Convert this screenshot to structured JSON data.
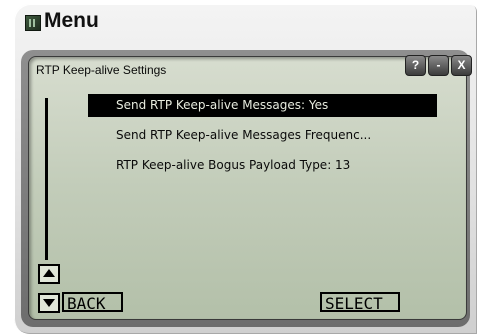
{
  "window": {
    "title": "Menu"
  },
  "screen": {
    "title": "RTP Keep-alive Settings",
    "controls": {
      "help": "?",
      "minimize": "-",
      "close": "X"
    }
  },
  "menu_items": [
    {
      "label": "Send RTP Keep-alive Messages: Yes",
      "selected": true
    },
    {
      "label": "Send RTP Keep-alive Messages Frequenc...",
      "selected": false
    },
    {
      "label": "RTP Keep-alive Bogus Payload Type: 13",
      "selected": false
    }
  ],
  "softkeys": {
    "left": "BACK",
    "right": "SELECT"
  },
  "icons": {
    "app": "menu-app-icon",
    "scroll_up": "triangle-up-icon",
    "scroll_down": "triangle-down-icon"
  },
  "colors": {
    "lcd_background": "#c2ccb9",
    "selection": "#000000",
    "selection_text": "#e8ecdf"
  }
}
